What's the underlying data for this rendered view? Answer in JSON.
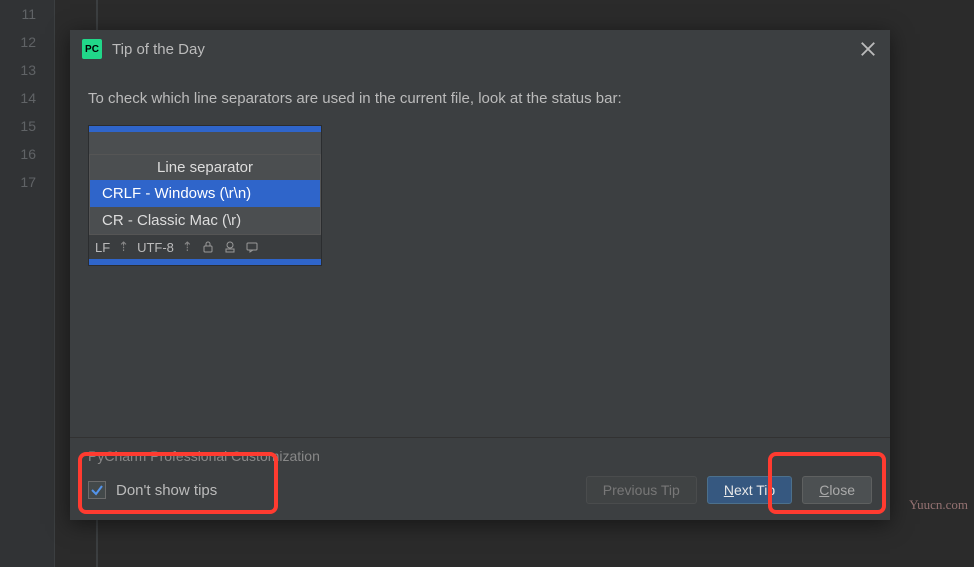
{
  "gutter": {
    "lines": [
      "11",
      "12",
      "13",
      "14",
      "15",
      "16",
      "17"
    ]
  },
  "dialog": {
    "app_icon_text": "PC",
    "title": "Tip of the Day",
    "tip_text": "To check which line separators are used in the current file, look at the status bar:",
    "menu": {
      "header": "Line separator",
      "selected": "CRLF - Windows (\\r\\n)",
      "other": "CR - Classic Mac (\\r)"
    },
    "mini_status": {
      "lf": "LF",
      "enc": "UTF-8"
    },
    "footer_label": "PyCharm Professional Customization",
    "checkbox": {
      "checked": true,
      "label": "Don't show tips"
    },
    "buttons": {
      "prev": "Previous Tip",
      "next_prefix": "N",
      "next_rest": "ext Tip",
      "close_prefix": "C",
      "close_rest": "lose"
    }
  },
  "watermark": "Yuucn.com"
}
